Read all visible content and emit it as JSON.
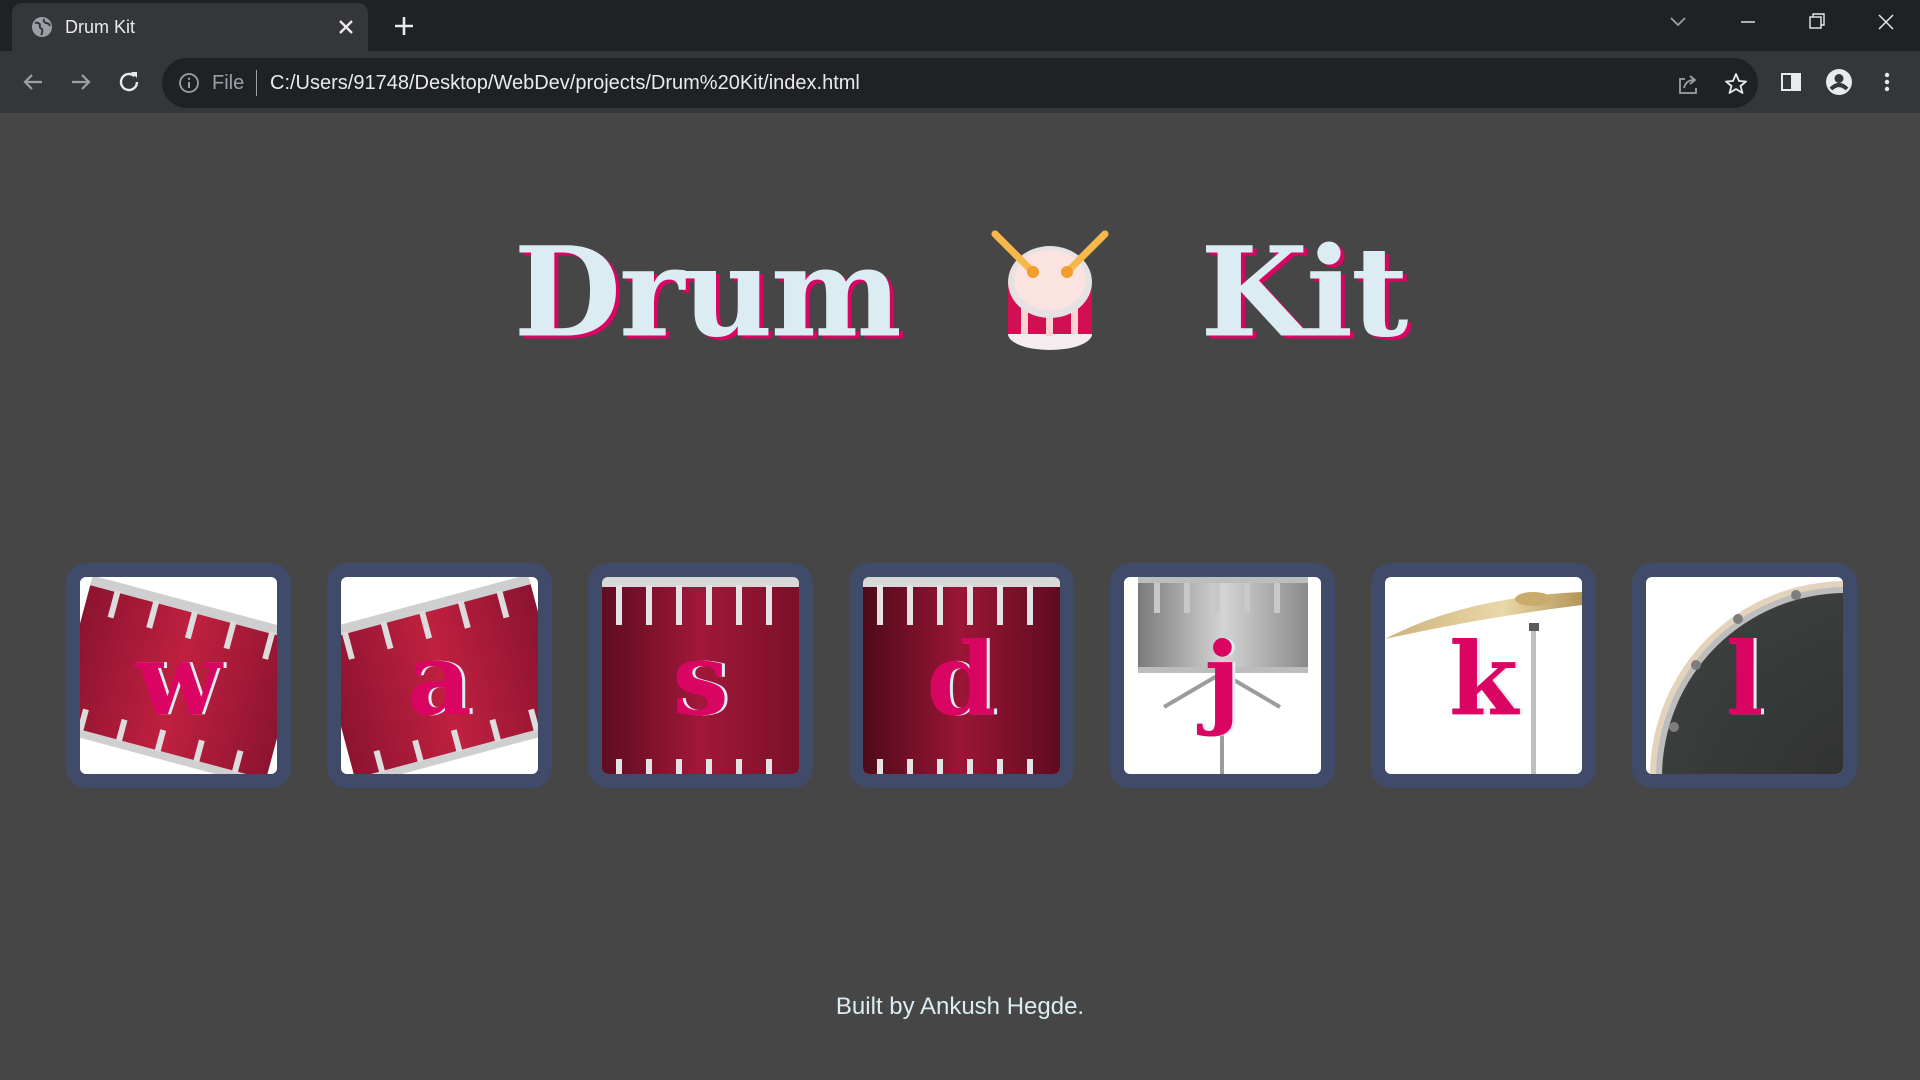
{
  "browser": {
    "tab_title": "Drum Kit",
    "file_label": "File",
    "url": "C:/Users/91748/Desktop/WebDev/projects/Drum%20Kit/index.html",
    "icons": [
      "globe-icon",
      "close-icon",
      "plus-icon",
      "chevron-down-icon",
      "minimize-icon",
      "restore-icon",
      "close-window-icon",
      "back-icon",
      "forward-icon",
      "reload-icon",
      "info-icon",
      "share-icon",
      "star-icon",
      "side-panel-icon",
      "profile-icon",
      "menu-icon"
    ]
  },
  "page": {
    "title_left": "Drum",
    "title_right": "Kit",
    "title_emoji": "drum-icon",
    "drums": [
      {
        "key": "w",
        "image": "tom-drum-tilted"
      },
      {
        "key": "a",
        "image": "tom-drum-tilted"
      },
      {
        "key": "s",
        "image": "floor-tom"
      },
      {
        "key": "d",
        "image": "floor-tom"
      },
      {
        "key": "j",
        "image": "snare-drum"
      },
      {
        "key": "k",
        "image": "crash-cymbal"
      },
      {
        "key": "l",
        "image": "kick-drum"
      }
    ],
    "footer": "Built by Ankush Hegde."
  },
  "colors": {
    "background": "#464646",
    "accent": "#da0463",
    "title_text": "#dbedf3",
    "button_border": "#404b69",
    "drum_red": "#a1173a"
  }
}
